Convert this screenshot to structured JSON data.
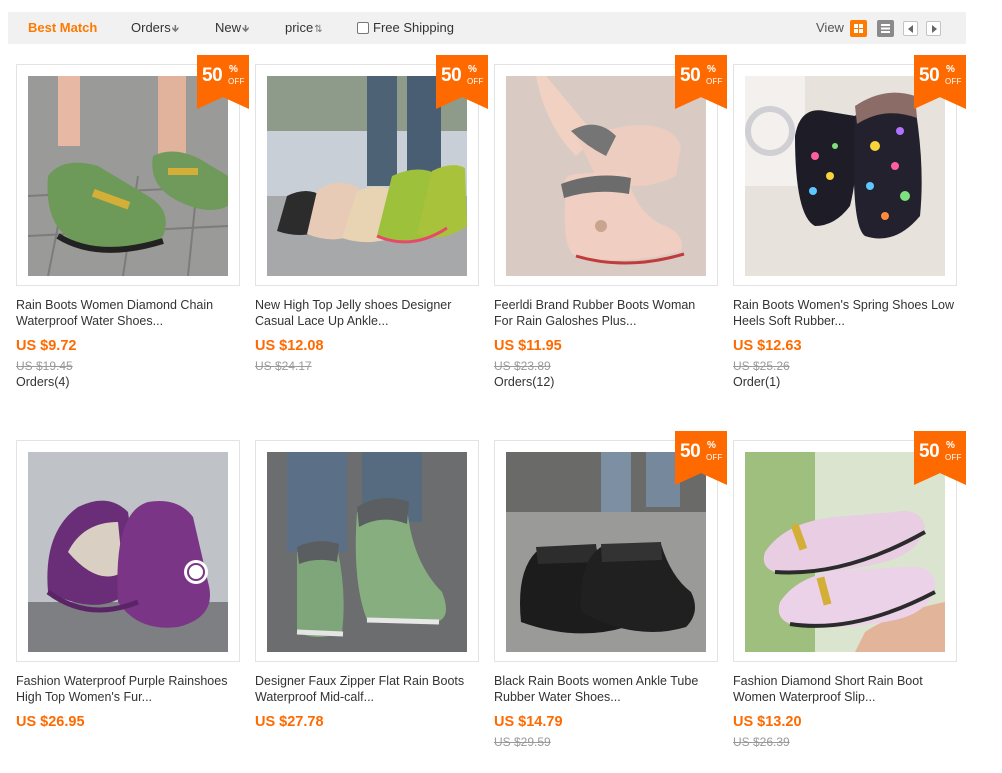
{
  "sortbar": {
    "best_match": "Best Match",
    "orders": "Orders",
    "new": "New",
    "price": "price",
    "free_shipping": "Free Shipping",
    "view_label": "View"
  },
  "colors": {
    "accent": "#ff7a00",
    "price": "#ff6a00",
    "badge": "#ff6a00"
  },
  "products": [
    {
      "title": "Rain Boots Women Diamond Chain\nWaterproof Water Shoes...",
      "price": "US $9.72",
      "old_price": "US $19.45",
      "orders": "Orders(4)",
      "badge": {
        "num": "50",
        "sign": "%",
        "off": "OFF"
      },
      "image": "green-loafers"
    },
    {
      "title": "New High Top Jelly shoes Designer\nCasual Lace Up Ankle...",
      "price": "US $12.08",
      "old_price": "US $24.17",
      "orders": "",
      "badge": {
        "num": "50",
        "sign": "%",
        "off": "OFF"
      },
      "image": "jelly-ankle-boots"
    },
    {
      "title": "Feerldi Brand Rubber Boots Woman\nFor Rain Galoshes Plus...",
      "price": "US $11.95",
      "old_price": "US $23.89",
      "orders": "Orders(12)",
      "badge": {
        "num": "50",
        "sign": "%",
        "off": "OFF"
      },
      "image": "pink-rubber-boots"
    },
    {
      "title": "Rain Boots Women's Spring Shoes Low\nHeels Soft Rubber...",
      "price": "US $12.63",
      "old_price": "US $25.26",
      "orders": "Order(1)",
      "badge": {
        "num": "50",
        "sign": "%",
        "off": "OFF"
      },
      "image": "polka-dot-boots"
    },
    {
      "title": "Fashion Waterproof Purple Rainshoes\nHigh Top Women's Fur...",
      "price": "US $26.95",
      "old_price": "",
      "orders": "",
      "badge": null,
      "image": "purple-high-top"
    },
    {
      "title": "Designer Faux Zipper Flat Rain Boots\nWaterproof Mid-calf...",
      "price": "US $27.78",
      "old_price": "",
      "orders": "",
      "badge": null,
      "image": "green-ankle-boots"
    },
    {
      "title": "Black Rain Boots women Ankle Tube\nRubber Water Shoes...",
      "price": "US $14.79",
      "old_price": "US $29.59",
      "orders": "",
      "badge": {
        "num": "50",
        "sign": "%",
        "off": "OFF"
      },
      "image": "black-ankle-boots"
    },
    {
      "title": "Fashion Diamond Short Rain Boot\nWomen Waterproof Slip...",
      "price": "US $13.20",
      "old_price": "US $26.39",
      "orders": "",
      "badge": {
        "num": "50",
        "sign": "%",
        "off": "OFF"
      },
      "image": "pink-loafers"
    }
  ]
}
